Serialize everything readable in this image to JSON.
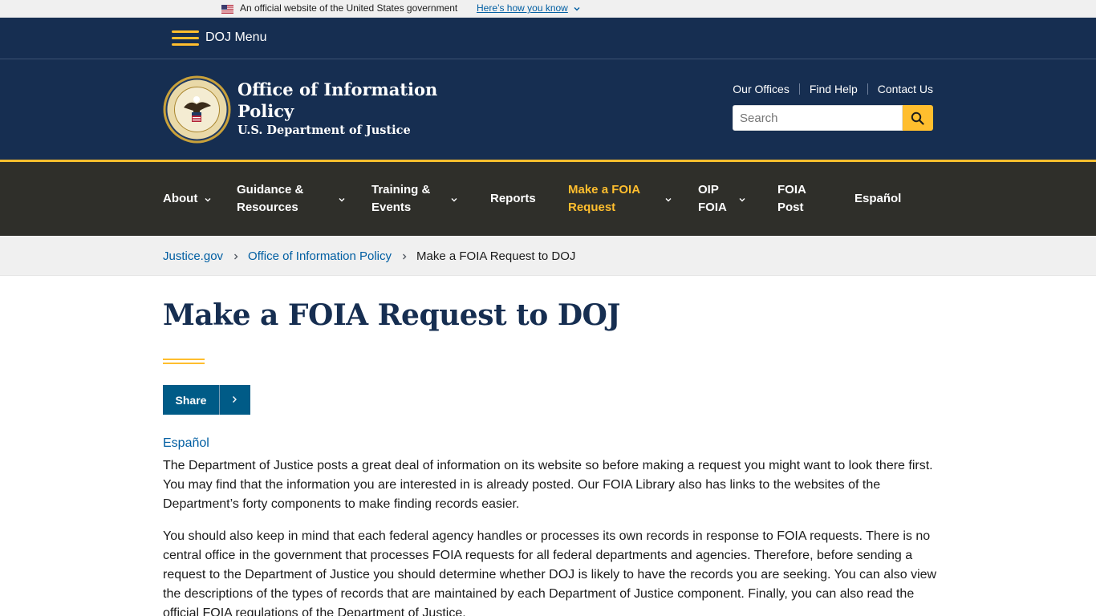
{
  "gov_banner": {
    "text": "An official website of the United States government",
    "link": "Here’s how you know"
  },
  "menu": {
    "label": "DOJ Menu"
  },
  "header": {
    "title": "Office of Information Policy",
    "subtitle": "U.S. Department of Justice",
    "util_links": [
      "Our Offices",
      "Find Help",
      "Contact Us"
    ],
    "search_placeholder": "Search"
  },
  "nav": {
    "items": [
      {
        "label": "About",
        "has_dropdown": true
      },
      {
        "label": "Guidance & Resources",
        "has_dropdown": true
      },
      {
        "label": "Training & Events",
        "has_dropdown": true
      },
      {
        "label": "Reports",
        "has_dropdown": false
      },
      {
        "label": "Make a FOIA Request",
        "has_dropdown": true,
        "active": true
      },
      {
        "label": "OIP FOIA",
        "has_dropdown": true
      },
      {
        "label": "FOIA Post",
        "has_dropdown": false
      },
      {
        "label": "Español",
        "has_dropdown": false
      }
    ]
  },
  "breadcrumb": {
    "items": [
      "Justice.gov",
      "Office of Information Policy"
    ],
    "current": "Make a FOIA Request to DOJ"
  },
  "main": {
    "title": "Make a FOIA Request to DOJ",
    "share_label": "Share",
    "espanol_link": "Español",
    "paragraphs": [
      "The Department of Justice posts a great deal of information on its website so before making a request you might want to look there first.  You may find that the information you are interested in is already posted.  Our FOIA Library also has links to the websites of the Department’s forty components to make finding records easier.",
      "You should also keep in mind that each federal agency handles or processes its own records in response to FOIA requests.  There is no central office in the government that processes FOIA requests for all federal departments and agencies. Therefore, before sending a request to the Department of Justice you should determine whether DOJ is likely to have the records you are seeking.  You can also view the descriptions of the types of records that are maintained by each Department of Justice component. Finally, you can also read the official FOIA regulations of the Department of Justice."
    ]
  },
  "colors": {
    "navy": "#162e51",
    "gold": "#ffbe2e",
    "nav_bg": "#2f2f2a",
    "link": "#005ea2",
    "share_bg": "#005b87"
  },
  "icons": [
    "us-flag-icon",
    "chevron-down-icon",
    "hamburger-icon",
    "doj-seal-icon",
    "search-icon",
    "chevron-right-icon"
  ]
}
